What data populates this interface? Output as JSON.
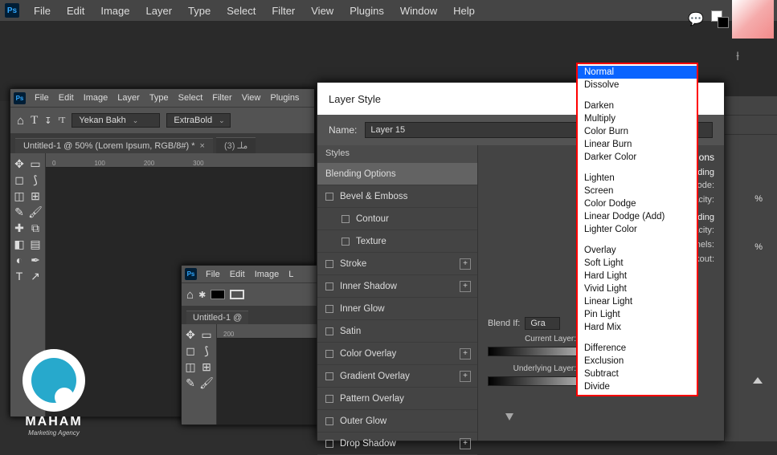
{
  "app": {
    "icon": "Ps"
  },
  "menubar": [
    "File",
    "Edit",
    "Image",
    "Layer",
    "Type",
    "Select",
    "Filter",
    "View",
    "Plugins",
    "Window",
    "Help"
  ],
  "nested": {
    "menubar": [
      "File",
      "Edit",
      "Image",
      "Layer",
      "Type",
      "Select",
      "Filter",
      "View",
      "Plugins"
    ],
    "font_family": "Yekan Bakh",
    "font_weight": "ExtraBold",
    "tab1": "Untitled-1 @ 50% (Lorem Ipsum, RGB/8#) *",
    "tab1_close": "×",
    "tab2": "(3) ملـ"
  },
  "nested2": {
    "menubar": [
      "File",
      "Edit",
      "Image",
      "L"
    ],
    "tab": "Untitled-1 @"
  },
  "logo": {
    "brand": "MAHAM",
    "tag": "Marketing Agency"
  },
  "dialog": {
    "title": "Layer Style",
    "name_label": "Name:",
    "name_value": "Layer 15",
    "styles_header": "Styles",
    "styles": [
      {
        "label": "Blending Options",
        "active": true,
        "chk": false
      },
      {
        "label": "Bevel & Emboss",
        "chk": true
      },
      {
        "label": "Contour",
        "sub": true,
        "chk": true
      },
      {
        "label": "Texture",
        "sub": true,
        "chk": true
      },
      {
        "label": "Stroke",
        "chk": true,
        "plus": true
      },
      {
        "label": "Inner Shadow",
        "chk": true,
        "plus": true
      },
      {
        "label": "Inner Glow",
        "chk": true
      },
      {
        "label": "Satin",
        "chk": true
      },
      {
        "label": "Color Overlay",
        "chk": true,
        "plus": true
      },
      {
        "label": "Gradient Overlay",
        "chk": true,
        "plus": true
      },
      {
        "label": "Pattern Overlay",
        "chk": true
      },
      {
        "label": "Outer Glow",
        "chk": true
      },
      {
        "label": "Drop Shadow",
        "chk": true,
        "plus": true
      }
    ],
    "blend": {
      "title": "Blending Options",
      "general": "General Blending",
      "mode_lbl": "Blend Mode:",
      "opacity_lbl": "Opacity:",
      "advanced": "Advanced Blending",
      "fill_lbl": "Fill Opacity:",
      "channels_lbl": "Channels:",
      "knockout_lbl": "Knockout:",
      "blendif_lbl": "Blend If:",
      "blendif_val": "Gra",
      "current_lbl": "Current Layer:",
      "underlying_lbl": "Underlying Layer:"
    }
  },
  "dropdown": {
    "groups": [
      [
        "Normal",
        "Dissolve"
      ],
      [
        "Darken",
        "Multiply",
        "Color Burn",
        "Linear Burn",
        "Darker Color"
      ],
      [
        "Lighten",
        "Screen",
        "Color Dodge",
        "Linear Dodge (Add)",
        "Lighter Color"
      ],
      [
        "Overlay",
        "Soft Light",
        "Hard Light",
        "Vivid Light",
        "Linear Light",
        "Pin Light",
        "Hard Mix"
      ],
      [
        "Difference",
        "Exclusion",
        "Subtract",
        "Divide"
      ]
    ],
    "selected": "Normal"
  },
  "pct": "%"
}
